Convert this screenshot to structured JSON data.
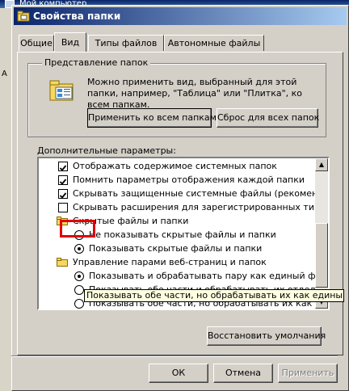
{
  "background_window": {
    "title": "Мой компьютер",
    "letter": "A"
  },
  "dialog": {
    "title": "Свойства папки",
    "tabs": [
      {
        "label": "Общие"
      },
      {
        "label": "Вид"
      },
      {
        "label": "Типы файлов"
      },
      {
        "label": "Автономные файлы"
      }
    ],
    "folder_view": {
      "group_label": "Представление папок",
      "description": "Можно применить вид, выбранный для этой папки, например, \"Таблица\" или \"Плитка\", ко всем папкам.",
      "apply_all_label": "Применить ко всем папкам",
      "reset_all_label": "Сброс для всех папок"
    },
    "advanced_label": "Дополнительные параметры:",
    "list_items": [
      {
        "text": "Отображать содержимое системных папок",
        "control": "checkbox",
        "checked": true
      },
      {
        "text": "Помнить параметры отображения каждой папки",
        "control": "checkbox",
        "checked": true
      },
      {
        "text": "Скрывать защищенные системные файлы (рекомендуется)",
        "control": "checkbox",
        "checked": true
      },
      {
        "text": "Скрывать расширения для зарегистрированных типов файлов",
        "control": "checkbox",
        "checked": false
      },
      {
        "text": "Скрытые файлы и папки",
        "control": "folder"
      },
      {
        "text": "Не показывать скрытые файлы и папки",
        "control": "radio",
        "checked": false
      },
      {
        "text": "Показывать скрытые файлы и папки",
        "control": "radio",
        "checked": true
      },
      {
        "text": "Управление парами веб-страниц и папок",
        "control": "folder"
      },
      {
        "text": "Показывать и обрабатывать пару как единый файл",
        "control": "radio",
        "checked": true
      },
      {
        "text": "Показывать обе части и обрабатывать их отдельно",
        "control": "radio",
        "checked": false
      },
      {
        "text": "Показывать обе части, но обрабатывать их как единый файл",
        "control": "radio",
        "checked": false
      }
    ],
    "tooltip": "Показывать обе части, но обрабатывать их как единый файл",
    "restore_defaults_label": "Восстановить умолчания",
    "ok_label": "ОК",
    "cancel_label": "Отмена",
    "apply_label": "Применить"
  },
  "colors": {
    "highlight": "#e00000",
    "titlebar_start": "#0a246a",
    "titlebar_end": "#a6caf0",
    "face": "#d4d0c8"
  }
}
